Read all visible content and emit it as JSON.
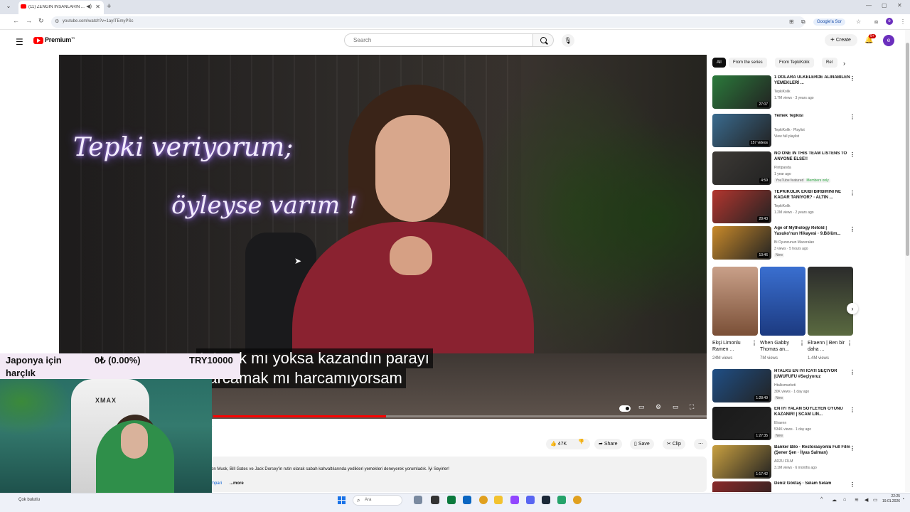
{
  "browser": {
    "tab_title": "(11) ZENGİN İNSANLARIN ...",
    "url": "youtube.com/watch?v=1ayITEmyPSc",
    "google_sor": "Google'a Sor",
    "profile_initial": "e"
  },
  "youtube": {
    "logo_text": "Premium",
    "logo_sup": "TR",
    "search_placeholder": "Search",
    "create_label": "Create",
    "notif_count": "9+",
    "avatar_initial": "e"
  },
  "player": {
    "neon_line1": "Tepki veriyorum;",
    "neon_line2": "öyleyse varım !",
    "subtitle_line1": "tutmak mı yoksa kazandın parayı",
    "subtitle_line2": "harcamak mı harcamıyorsam",
    "progress_fraction": 0.35
  },
  "below_video": {
    "title_fragment": "!",
    "like_count": "47K",
    "share_label": "Share",
    "save_label": "Save",
    "clip_label": "Clip",
    "description": "on Musk, Bill Gates ve Jack Dorsey'in rutin olarak sabah kahvaltılarında yedikleri yemekleri deneyerek yorumladık. İyi Seyirler!",
    "desc_link": "mpari",
    "more_label": "...more"
  },
  "sidebar": {
    "chips": [
      "All",
      "From the series",
      "From TepkiKolik",
      "Rel"
    ],
    "recommendations": [
      {
        "title": "1 DOLARA ÜLKELERDE ALINABİLEN YEMEKLERİ ...",
        "channel": "TepkiKolik",
        "meta": "1.7M views · 3 years ago",
        "duration": "27:07",
        "badge": "",
        "thumb": "#2b7a3b"
      },
      {
        "title": "Yemek Tepkisi",
        "channel": "TepkiKolik · Playlist",
        "meta": "View full playlist",
        "duration": "157 videos",
        "badge": "",
        "thumb": "#3a6b8f"
      },
      {
        "title": "NO ONE IN THIS TEAM LISTENS TO ANYONE ELSE!!",
        "channel": "Pintipanda",
        "meta": "1 year ago",
        "duration": "4:59",
        "badge": "YouTube featured",
        "members": "Members only",
        "thumb": "#3d3a36"
      },
      {
        "title": "TEPKİKOLİK EKİBİ BİRBİRİNİ NE KADAR TANIYOR? · ALTIN ...",
        "channel": "TepkiKolik",
        "meta": "1.2M views · 2 years ago",
        "duration": "28:43",
        "badge": "",
        "thumb": "#b3362f"
      },
      {
        "title": "Age of Mythology Retold | Yasuko'nun Hikayesi · 9.Bölüm...",
        "channel": "Bi Oyuncunun Maceraları",
        "meta": "3 views · 5 hours ago",
        "duration": "13:46",
        "badge": "New",
        "thumb": "#c98a2a"
      },
      {
        "title": "HTALKS EN İYİ İCATI SEÇİYOR |UWUFUFU #Seçiyoruz",
        "channel": "Htalksmarketi",
        "meta": "30K views · 1 day ago",
        "duration": "1:28:49",
        "badge": "New",
        "thumb": "#1f4f86"
      },
      {
        "title": "EN İYİ YALAN SÖYLEYEN OYUNU KAZANIR! | SCAM LIN...",
        "channel": "Elraenn",
        "meta": "534K views · 1 day ago",
        "duration": "1:27:35",
        "badge": "New",
        "thumb": "#1a1a1a"
      },
      {
        "title": "Banker Bilo · Restorasyonlu Full Film (Şener Şen · İlyas Salman)",
        "channel": "ARZU FİLM",
        "meta": "3.1M views · 6 months ago",
        "duration": "1:17:42",
        "badge": "",
        "thumb": "#c9a040"
      },
      {
        "title": "Deniz Göktaş · Selam Selam",
        "channel": "",
        "meta": "",
        "duration": "",
        "badge": "",
        "thumb": "#8a2a2a"
      }
    ],
    "shorts": [
      {
        "title": "Ekşi Limonlu Ramen ...",
        "views": "24M views",
        "thumb": "#a8674a"
      },
      {
        "title": "When Gabby Thomas an...",
        "views": "7M views",
        "thumb": "#2a4fa0"
      },
      {
        "title": "Elraenn | Ben bir daha ...",
        "views": "1.4M views",
        "thumb": "#4a4a3a"
      }
    ]
  },
  "overlay": {
    "ticker_label_line1": "Japonya için",
    "ticker_label_line2": "harçlık",
    "ticker_value": "0₺ (0.00%)",
    "ticker_goal": "TRY10000",
    "chair_brand": "XMAX"
  },
  "taskbar": {
    "weather": "Çok bulutlu",
    "search_placeholder": "Ara",
    "time": "22:25",
    "date": "19.01.2026"
  }
}
